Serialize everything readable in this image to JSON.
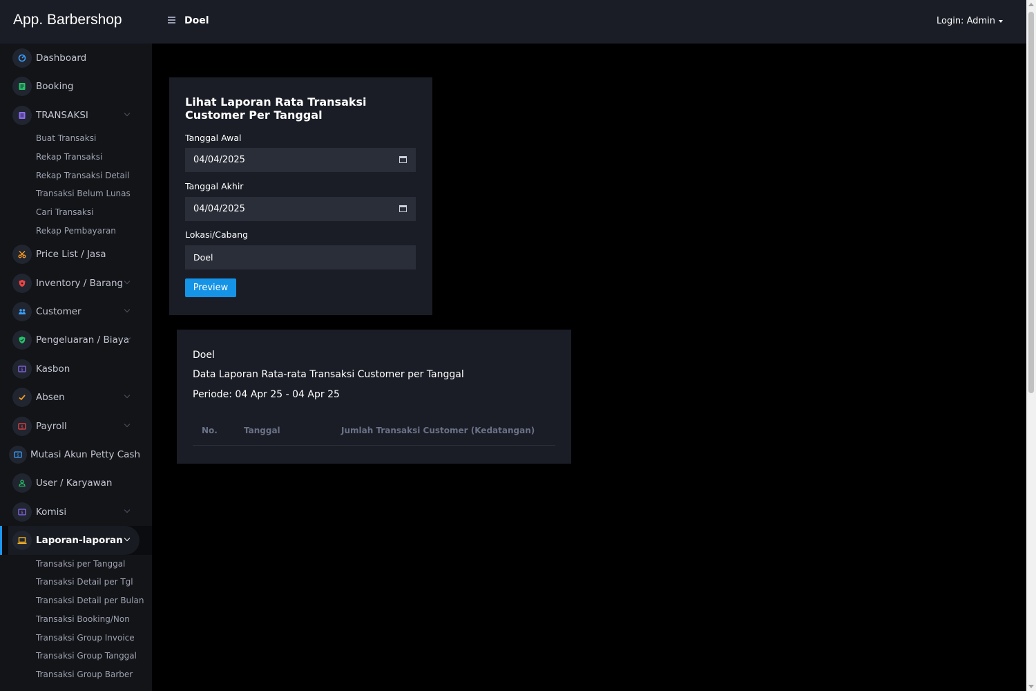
{
  "app": {
    "brand": "App. Barbershop",
    "title": "Doel",
    "login": "Login: Admin"
  },
  "sidebar": {
    "items": [
      {
        "label": "Dashboard",
        "icon": "gauge-icon",
        "color": "#3aa0ff"
      },
      {
        "label": "Booking",
        "icon": "document-icon",
        "color": "#23c36a"
      },
      {
        "label": "TRANSAKSI",
        "icon": "receipt-icon",
        "color": "#8b6cf0"
      },
      {
        "label": "Price List / Jasa",
        "icon": "scissors-icon",
        "color": "#f59a23"
      },
      {
        "label": "Inventory / Barang",
        "icon": "shield-icon",
        "color": "#ef4444"
      },
      {
        "label": "Customer",
        "icon": "users-icon",
        "color": "#3aa0ff"
      },
      {
        "label": "Pengeluaran / Biaya",
        "icon": "shield-check-icon",
        "color": "#23c36a"
      },
      {
        "label": "Kasbon",
        "icon": "money-icon",
        "color": "#8b6cf0"
      },
      {
        "label": "Absen",
        "icon": "check-icon",
        "color": "#f59a23"
      },
      {
        "label": "Payroll",
        "icon": "money-icon",
        "color": "#ef4444"
      },
      {
        "label": "Mutasi Akun Petty Cash",
        "icon": "money-icon",
        "color": "#3aa0ff"
      },
      {
        "label": "User / Karyawan",
        "icon": "user-icon",
        "color": "#23c36a"
      },
      {
        "label": "Komisi",
        "icon": "money-icon",
        "color": "#8b6cf0"
      },
      {
        "label": "Laporan-laporan",
        "icon": "laptop-icon",
        "color": "#f5b323"
      }
    ],
    "transaksi_sub": [
      "Buat Transaksi",
      "Rekap Transaksi",
      "Rekap Transaksi Detail",
      "Transaksi Belum Lunas",
      "Cari Transaksi",
      "Rekap Pembayaran"
    ],
    "laporan_sub": [
      "Transaksi per Tanggal",
      "Transaksi Detail per Tgl",
      "Transaksi Detail per Bulan",
      "Transaksi Booking/Non",
      "Transaksi Group Invoice",
      "Transaksi Group Tanggal",
      "Transaksi Group Barber"
    ]
  },
  "form": {
    "heading": "Lihat Laporan Rata Transaksi Customer Per Tanggal",
    "start_label": "Tanggal Awal",
    "start_value": "04/04/2025",
    "end_label": "Tanggal Akhir",
    "end_value": "04/04/2025",
    "location_label": "Lokasi/Cabang",
    "location_value": "Doel",
    "preview_label": "Preview"
  },
  "report": {
    "branch": "Doel",
    "title": "Data Laporan Rata-rata Transaksi Customer per Tanggal",
    "period": "Periode: 04 Apr 25 - 04 Apr 25",
    "columns": [
      "No.",
      "Tanggal",
      "Jumlah Transaksi Customer (Kedatangan)"
    ]
  }
}
